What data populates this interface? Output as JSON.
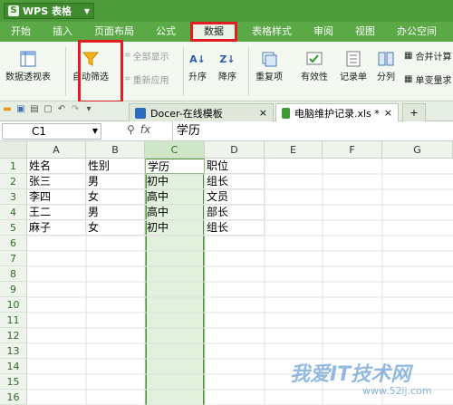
{
  "app": {
    "title": "WPS 表格"
  },
  "menu": [
    "开始",
    "插入",
    "页面布局",
    "公式",
    "数据",
    "表格样式",
    "审阅",
    "视图",
    "办公空间"
  ],
  "menu_active": "数据",
  "ribbon": {
    "pivot": "数据透视表",
    "autofilter": "自动筛选",
    "show_all": "全部显示",
    "reapply": "重新应用",
    "sort_asc": "升序",
    "sort_desc": "降序",
    "duplicates": "重复项",
    "validity": "有效性",
    "records": "记录单",
    "split": "分列",
    "merge_calc": "合并计算",
    "simulate": "单变量求"
  },
  "tabs": {
    "docer": "Docer-在线模板",
    "file": "电脑维护记录.xls *",
    "add": "+"
  },
  "formula_bar": {
    "cell_ref": "C1",
    "fx": "fx",
    "value": "学历"
  },
  "columns": [
    "A",
    "B",
    "C",
    "D",
    "E",
    "F",
    "G"
  ],
  "rows": [
    "1",
    "2",
    "3",
    "4",
    "5",
    "6",
    "7",
    "8",
    "9",
    "10",
    "11",
    "12",
    "13",
    "14",
    "15",
    "16"
  ],
  "cells": [
    [
      "姓名",
      "性别",
      "学历",
      "职位"
    ],
    [
      "张三",
      "男",
      "初中",
      "组长"
    ],
    [
      "李四",
      "女",
      "高中",
      "文员"
    ],
    [
      "王二",
      "男",
      "高中",
      "部长"
    ],
    [
      "麻子",
      "女",
      "初中",
      "组长"
    ]
  ],
  "watermark": {
    "text": "我爱IT技术网",
    "url": "www.52ij.com"
  },
  "colors": {
    "accent": "#4d9b3a",
    "highlight": "#e31b23"
  }
}
